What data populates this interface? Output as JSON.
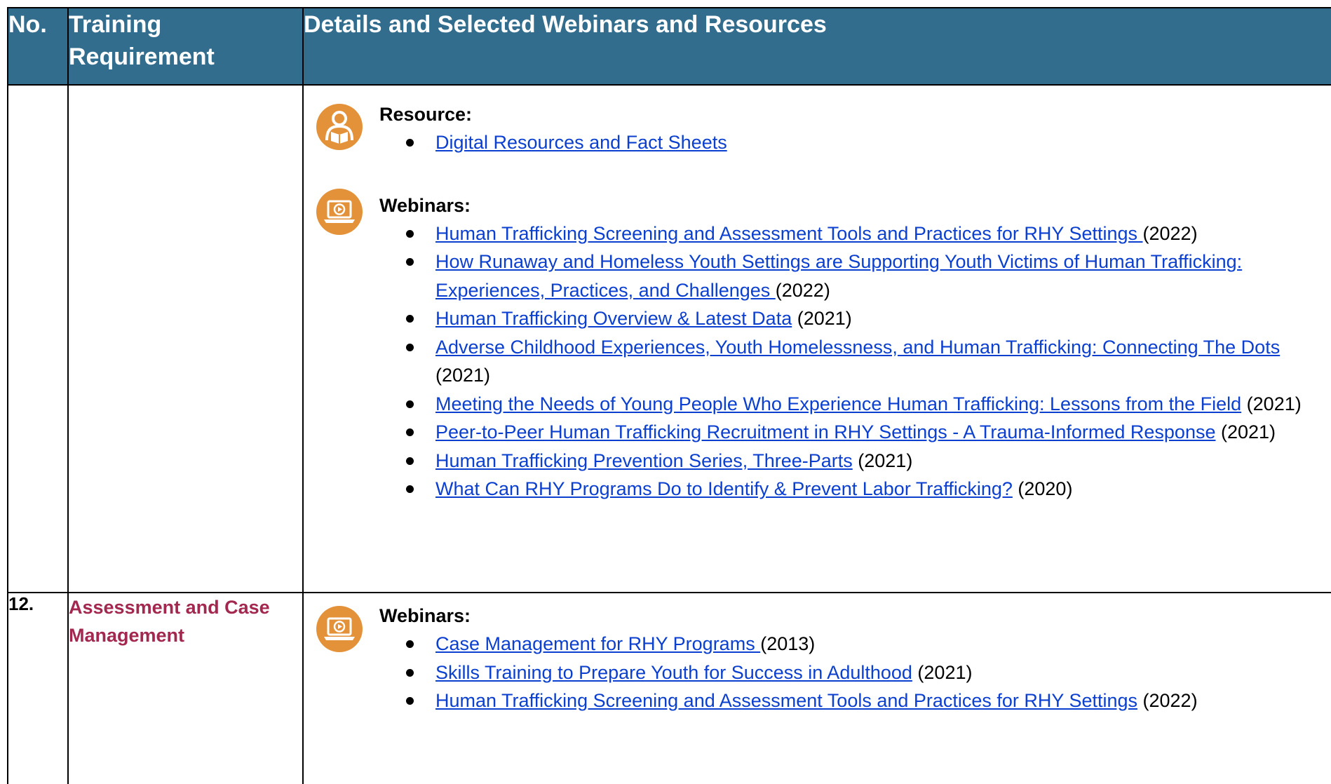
{
  "header": {
    "col_no": "No.",
    "col_requirement": "Training Requirement",
    "col_details": "Details and Selected Webinars and Resources"
  },
  "rows": [
    {
      "no": "",
      "requirement": "",
      "resource": {
        "icon": "reader-book-icon",
        "heading": "Resource:",
        "items": [
          {
            "link": "Digital Resources and Fact Sheets",
            "year": ""
          }
        ]
      },
      "webinars": {
        "icon": "laptop-play-icon",
        "heading": "Webinars:",
        "items": [
          {
            "link": "Human Trafficking Screening and Assessment Tools and Practices for RHY Settings ",
            "year": "(2022)"
          },
          {
            "link": "How Runaway and Homeless Youth Settings are Supporting Youth Victims of Human Trafficking: Experiences, Practices, and Challenges ",
            "year": "(2022)"
          },
          {
            "link": "Human Trafficking Overview & Latest Data",
            "year": " (2021)"
          },
          {
            "link": "Adverse Childhood Experiences, Youth Homelessness, and Human Trafficking: Connecting The Dots ",
            "year": " (2021)"
          },
          {
            "link": "Meeting the Needs of Young People Who Experience Human Trafficking: Lessons from the Field",
            "year": " (2021)"
          },
          {
            "link": "Peer-to-Peer Human Trafficking Recruitment in RHY Settings - A Trauma-Informed Response",
            "year": " (2021)"
          },
          {
            "link": "Human Trafficking Prevention Series, Three-Parts",
            "year": " (2021)"
          },
          {
            "link": "What Can RHY Programs Do to Identify & Prevent Labor Trafficking?",
            "year": " (2020)"
          }
        ]
      }
    },
    {
      "no": "12.",
      "requirement": "Assessment and Case Management",
      "webinars": {
        "icon": "laptop-play-icon",
        "heading": "Webinars:",
        "items": [
          {
            "link": "Case Management for RHY Programs ",
            "year": "(2013)"
          },
          {
            "link": "Skills Training to Prepare Youth for Success in Adulthood",
            "year": " (2021)"
          },
          {
            "link": "Human Trafficking Screening and Assessment Tools and Practices for RHY Settings",
            "year": " (2022)"
          }
        ]
      }
    }
  ],
  "colors": {
    "header_bg": "#336d8e",
    "header_text": "#ffffff",
    "requirement_text": "#a3284f",
    "icon_bg": "#e3923a",
    "link": "#0b3fcf"
  }
}
